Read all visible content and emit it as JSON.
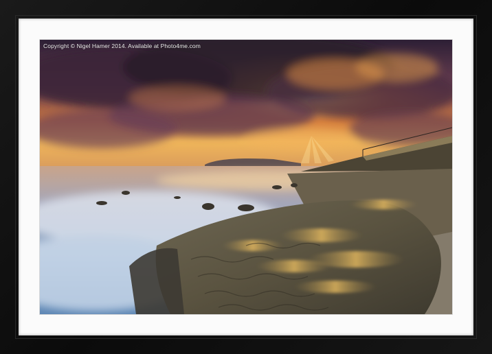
{
  "product": {
    "type": "framed mounted print"
  },
  "photo": {
    "watermark": "Copyright © Nigel Hamer 2014. Available at Photo4me.com"
  },
  "colors": {
    "frame": "#111111",
    "mount": "#fbfbfb",
    "sky_gold": "#f2a43a",
    "cloud_purple": "#5a3a5c",
    "sea": "#8aa6c4"
  }
}
